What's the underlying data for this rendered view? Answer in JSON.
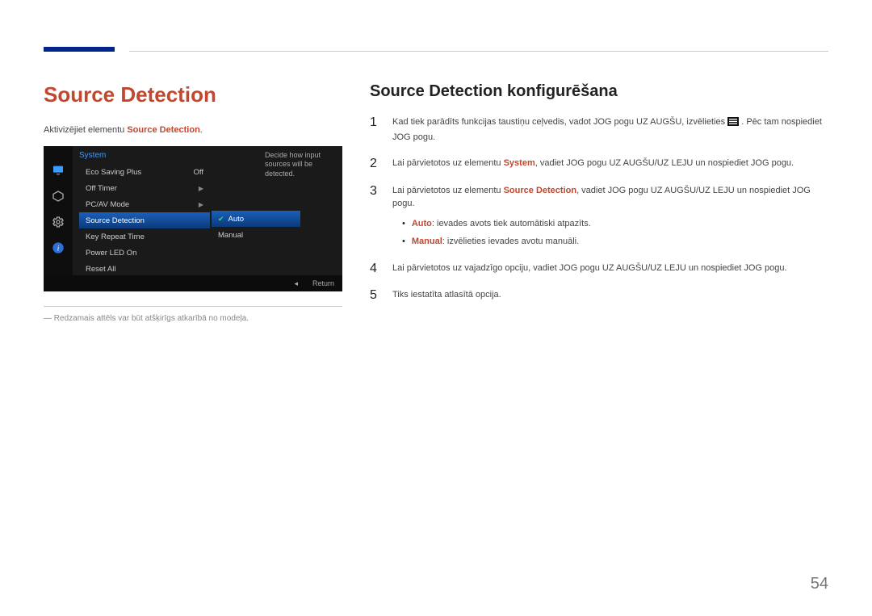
{
  "page_number": "54",
  "heading_main": "Source Detection",
  "intro_prefix": "Aktivizējiet elementu ",
  "intro_bold": "Source Detection",
  "intro_suffix": ".",
  "osd": {
    "title": "System",
    "items": [
      {
        "label": "Eco Saving Plus",
        "value": "Off"
      },
      {
        "label": "Off Timer",
        "value": ""
      },
      {
        "label": "PC/AV Mode",
        "value": ""
      },
      {
        "label": "Source Detection",
        "value": ""
      },
      {
        "label": "Key Repeat Time",
        "value": ""
      },
      {
        "label": "Power LED On",
        "value": ""
      },
      {
        "label": "Reset All",
        "value": ""
      }
    ],
    "selected_index": 3,
    "sub_items": [
      {
        "label": "Auto",
        "checked": true
      },
      {
        "label": "Manual",
        "checked": false
      }
    ],
    "sub_selected_index": 0,
    "info_text": "Decide how input sources will be detected.",
    "return_label": "Return"
  },
  "caption_prefix": "― ",
  "caption": "Redzamais attēls var būt atšķirīgs atkarībā no modeļa.",
  "heading_sub": "Source Detection konfigurēšana",
  "steps": {
    "s1_a": "Kad tiek parādīts funkcijas taustiņu ceļvedis, vadot JOG pogu UZ AUGŠU, izvēlieties ",
    "s1_b": ". Pēc tam nospiediet JOG pogu.",
    "s2_a": "Lai pārvietotos uz elementu ",
    "s2_bold": "System",
    "s2_b": ", vadiet JOG pogu UZ AUGŠU/UZ LEJU un nospiediet JOG pogu.",
    "s3_a": "Lai pārvietotos uz elementu ",
    "s3_bold": "Source Detection",
    "s3_b": ", vadiet JOG pogu UZ AUGŠU/UZ LEJU un nospiediet JOG pogu.",
    "b1_bold": "Auto",
    "b1_text": ": ievades avots tiek automātiski atpazīts.",
    "b2_bold": "Manual",
    "b2_text": ": izvēlieties ievades avotu manuāli.",
    "s4": "Lai pārvietotos uz vajadzīgo opciju, vadiet JOG pogu UZ AUGŠU/UZ LEJU un nospiediet JOG pogu.",
    "s5": "Tiks iestatīta atlasītā opcija."
  }
}
